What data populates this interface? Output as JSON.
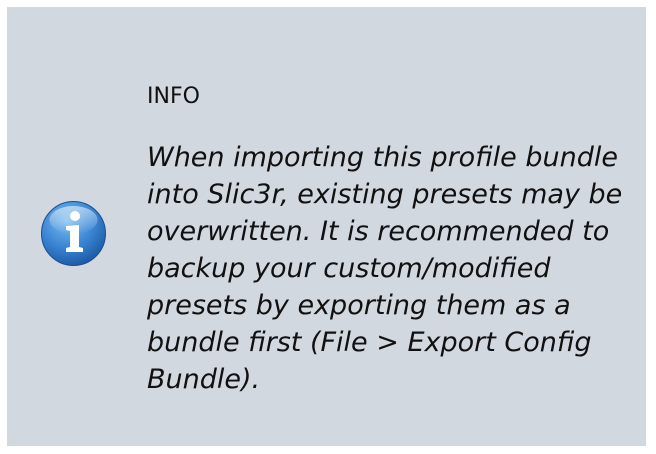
{
  "note": {
    "icon": "info-icon",
    "title": "INFO",
    "lines": [
      "When importing this profile bundle",
      "into Slic3r, existing presets may be",
      "overwritten. It is recommended to",
      "backup your custom/modified",
      "presets by exporting them as a",
      "bundle first (File > Export Config",
      "Bundle)."
    ]
  },
  "colors": {
    "background": "#d2d8e0",
    "icon_gradient_top": "#5aa7e8",
    "icon_gradient_bottom": "#1f5fa8",
    "text": "#111111"
  }
}
